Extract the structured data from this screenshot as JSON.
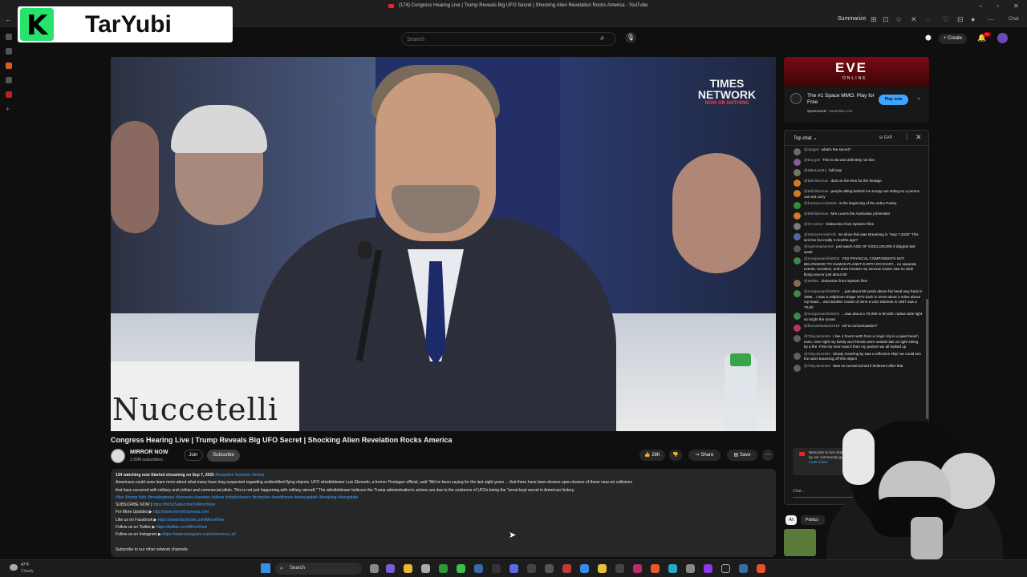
{
  "browser": {
    "tab_title": "(174) Congress Hearing Live | Trump Reveals Big UFO Secret | Shocking Alien Revelation Rocks America - YouTube",
    "summarize_label": "Summarize",
    "chat_label": "Chat"
  },
  "logo": {
    "name": "TarYubi"
  },
  "masthead": {
    "search_placeholder": "Search",
    "create_label": "Create",
    "notification_count": "9+"
  },
  "player": {
    "nameplate": "Nuccetelli",
    "network_logo": "TIMES NETWORK",
    "network_tagline": "NOW OR NOTHING"
  },
  "video": {
    "title": "Congress Hearing Live | Trump Reveals Big UFO Secret | Shocking Alien Revelation Rocks America",
    "channel": "MIRROR NOW",
    "subscribers": "1.99M subscribers",
    "join_label": "Join",
    "subscribe_label": "Subscribe",
    "likes": "28K",
    "share_label": "Share",
    "save_label": "Save"
  },
  "description": {
    "stats": "134 watching now  Started streaming on Sep 7, 2025",
    "hashtags_top": "#trumplive #usnews #trump",
    "para1": "Americans could soon learn more about what many have long suspected regarding unidentified flying objects. UFO whistleblower Luis Elizondo, a former Pentagon official, said \"We've been saying for the last eight years ... that there have been dozens upon dozens of these near-air collisions",
    "para2": "that have occurred with military and civilian and commercial pilots. This is not just happening with military aircraft.\" The whistleblower believes the Trump administration's actions are due to the existence of UFOs being the \"worst-kept secret in American history.",
    "hashtags": "#live #trump #ufo #breakingnews #livenews #usnews #aliens #ufodisclosure #trumplive #worldnews #newsupdate #breaking #liveupdate",
    "subscribe_now": "SUBSCRIBE NOW |",
    "subscribe_link": "https://bit.ly/SubscribeToMirrorNow",
    "updates_label": "For More Updates ▶",
    "updates_link": "http://www.mirrornownews.com",
    "facebook_label": "Like us on Facebook ▶",
    "facebook_link": "https://www.facebook.com/MirrorNow",
    "twitter_label": "Follow us on Twitter ▶",
    "twitter_link": "https://twitter.com/MirrorNow",
    "instagram_label": "Follow us on Instagram ▶",
    "instagram_link": "https://www.instagram.com/mirrornow_in/",
    "other_channels": "Subscribe to our other network channels:"
  },
  "ad": {
    "banner_title": "EVE",
    "banner_sub": "ONLINE",
    "title": "The #1 Space MMO. Play for Free",
    "sponsor": "Sponsored",
    "domain": "eveonline.com",
    "cta": "Play now"
  },
  "chat": {
    "header": "Top chat",
    "gxp": "GXP",
    "messages": [
      {
        "author": "@Jaxjyni",
        "text": "what's the secret?",
        "color": "#6a6a6a"
      },
      {
        "author": "@Eurypsi",
        "text": "This is old and definitely not live.",
        "color": "#8a5a9a"
      },
      {
        "author": "@NikeLar642",
        "text": "full loop",
        "color": "#6b7b5b"
      },
      {
        "author": "@BillAlderman",
        "text": "dust on the lens for the footage",
        "color": "#d07a2a"
      },
      {
        "author": "@BillAlderman",
        "text": "people sitting behind me Knapp are sitting so a person can eat curry",
        "color": "#d07a2a"
      },
      {
        "author": "@franksaccio89289",
        "text": "is the beginning of the video Poetry",
        "color": "#3a8a3a"
      },
      {
        "author": "@BillAlderman",
        "text": "Mrs Luna's the Australian priminister",
        "color": "#d07a2a"
      },
      {
        "author": "@SA-ko6vz",
        "text": "Distraction from Epstein Files",
        "color": "#7a7a7a"
      },
      {
        "author": "@HistoryHerald-i2k",
        "text": "So since this was streaming in \"Sep 7,2025\" This isnt live but really 3 months ago?",
        "color": "#4a6aaa"
      },
      {
        "author": "@rayleneplatense",
        "text": "just watch AGE OF DISCLOSURE it dripped last week",
        "color": "#555555"
      },
      {
        "author": "@morganearrillo6004",
        "text": "YES PHYSICAL COMPONENTS NOT BELONGING TO HUMAN PLANET EARTH DO EXIST... on separate events, occasion, and area location my second cousin saw so wide flying saucer just about 80",
        "color": "#3a8a4a"
      },
      {
        "author": "@Nellie2",
        "text": "distraction from Epstein files",
        "color": "#8a6a4a"
      },
      {
        "author": "@morganearrillo6004",
        "text": "...just about 80 yards above his head way back in 1965... I saw a cellphone shape UFO back in 2019 about 2 miles above my head.... and another cousin of mine a USA Marines in 1987 saw a 70,00",
        "color": "#3a8a4a"
      },
      {
        "author": "@morganearrillo6004",
        "text": "...saw about a 70,000 to 90,000. radius wide light so bright the ocean",
        "color": "#3a8a4a"
      },
      {
        "author": "@florinsebastian2418",
        "text": "wtf is comunicaation?",
        "color": "#b03a5a"
      },
      {
        "author": "@TobyJames94",
        "text": "I live 4 hours north from a major city in a quiet beach town. One night my family and friends were outside late at night sitting by a fire. First my mum saw it then my partner we all looked up",
        "color": "#606060"
      },
      {
        "author": "@TobyJames94",
        "text": "Slowly hovering by was a reflective ship' we could see the stars bouncing off this object",
        "color": "#606060"
      },
      {
        "author": "@TobyJames94",
        "text": "Was so surreal turned it believers after that",
        "color": "#606060"
      }
    ],
    "welcome": "Welcome to live chat! Remember to guard your privacy and abide by our community guidelines.",
    "learn_more": "Learn more",
    "input_placeholder": "Chat..."
  },
  "related": {
    "chip_all": "All",
    "chip_2": "Politics"
  },
  "taskbar": {
    "temp": "47°F",
    "condition": "Cloudy",
    "search_label": "Search"
  }
}
